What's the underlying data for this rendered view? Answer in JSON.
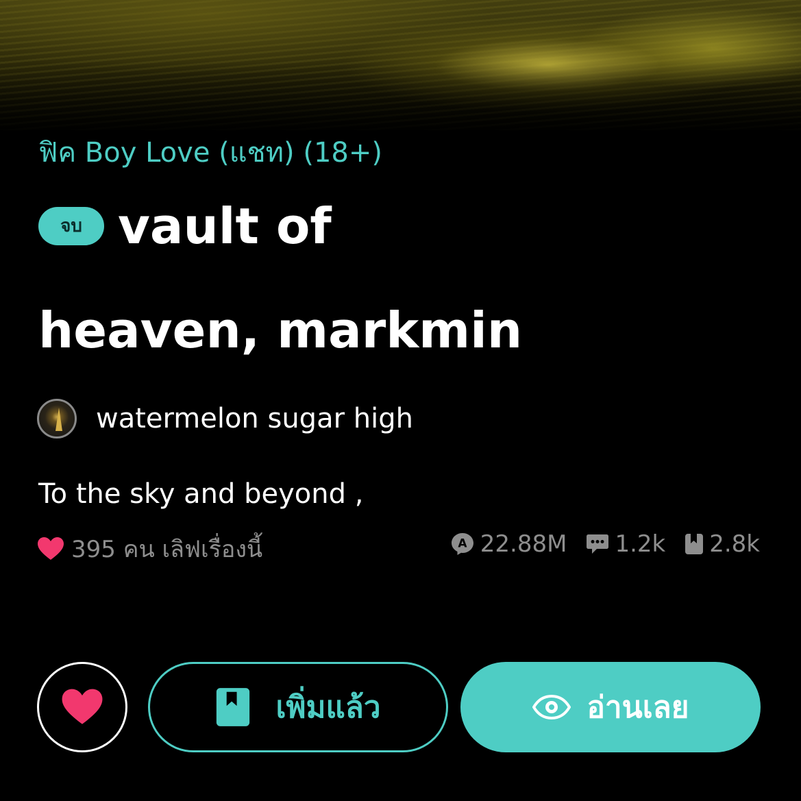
{
  "story": {
    "category": "ฟิค Boy Love (แชท) (18+)",
    "status_badge": "จบ",
    "title_line1": "vault of",
    "title_line2": "heaven, markmin",
    "author": "watermelon sugar high",
    "description": "To the sky and beyond ,"
  },
  "stats": {
    "likes_text": "395 คน เลิฟเรื่องนี้",
    "views": "22.88M",
    "comments": "1.2k",
    "bookmarks": "2.8k"
  },
  "actions": {
    "added_label": "เพิ่มแล้ว",
    "read_label": "อ่านเลย"
  },
  "icons": {
    "heart": "heart-icon",
    "views": "view-count-icon",
    "comments": "comment-icon",
    "bookmarks": "bookmark-icon",
    "eye": "eye-icon"
  },
  "colors": {
    "accent": "#4ecdc4",
    "heart": "#f2386e",
    "muted": "#8e8e8e",
    "background": "#000000"
  }
}
